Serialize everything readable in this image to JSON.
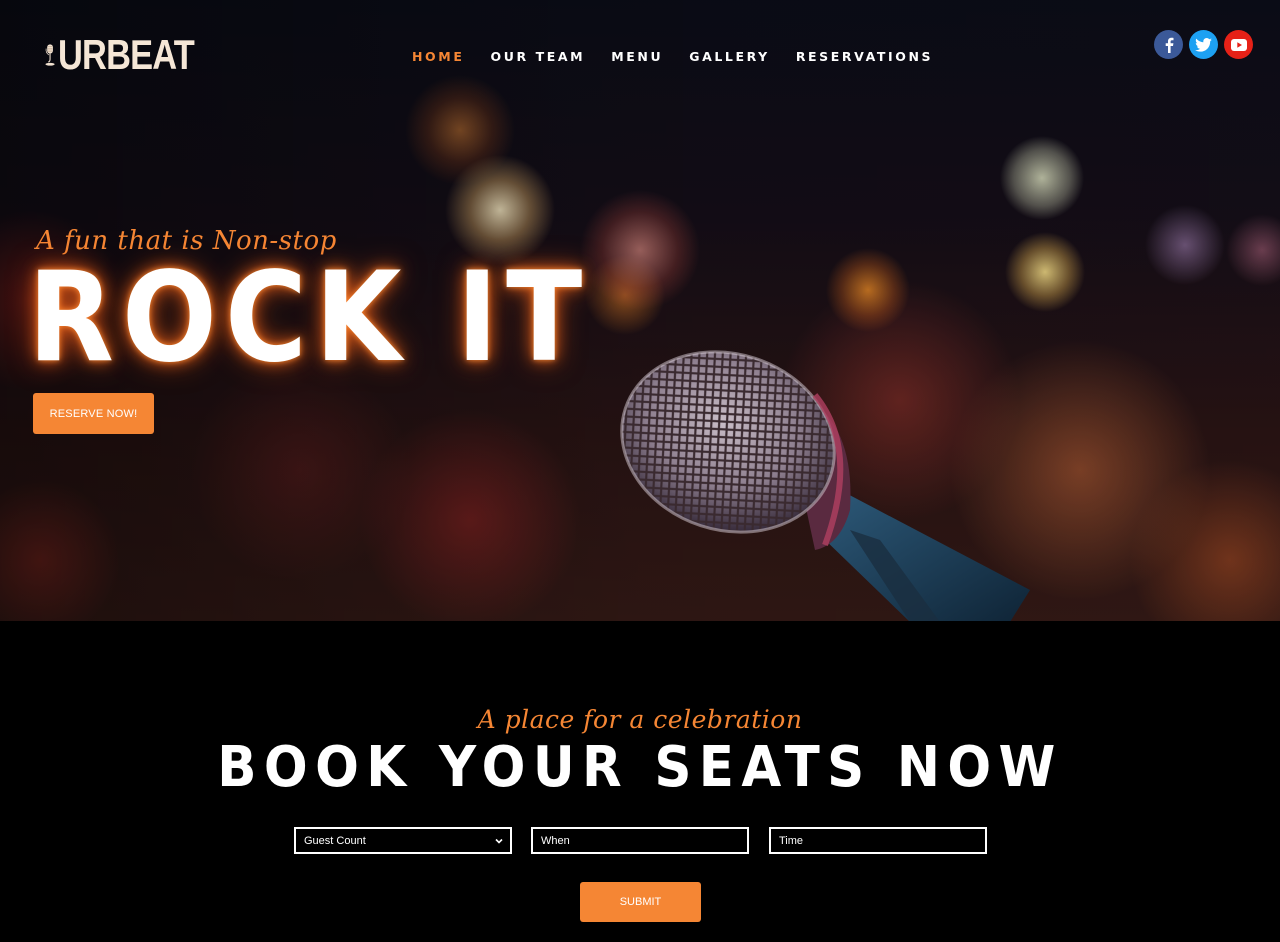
{
  "brand": {
    "name": "URBEAT",
    "accent": "#f58634"
  },
  "nav": {
    "items": [
      {
        "label": "HOME",
        "active": true
      },
      {
        "label": "OUR TEAM"
      },
      {
        "label": "MENU"
      },
      {
        "label": "GALLERY"
      },
      {
        "label": "RESERVATIONS"
      }
    ]
  },
  "social": [
    {
      "name": "facebook-icon",
      "color": "#3b5998"
    },
    {
      "name": "twitter-icon",
      "color": "#1da1f2"
    },
    {
      "name": "youtube-icon",
      "color": "#e62117"
    }
  ],
  "hero": {
    "tagline": "A fun that is Non-stop",
    "title": "ROCK IT",
    "button_label": "RESERVE NOW!"
  },
  "booking": {
    "tagline": "A place for a celebration",
    "title": "BOOK YOUR SEATS NOW",
    "guest_select": {
      "value": "Guest Count"
    },
    "when_field": {
      "placeholder": "When"
    },
    "time_field": {
      "placeholder": "Time"
    },
    "submit_label": "SUBMIT"
  }
}
